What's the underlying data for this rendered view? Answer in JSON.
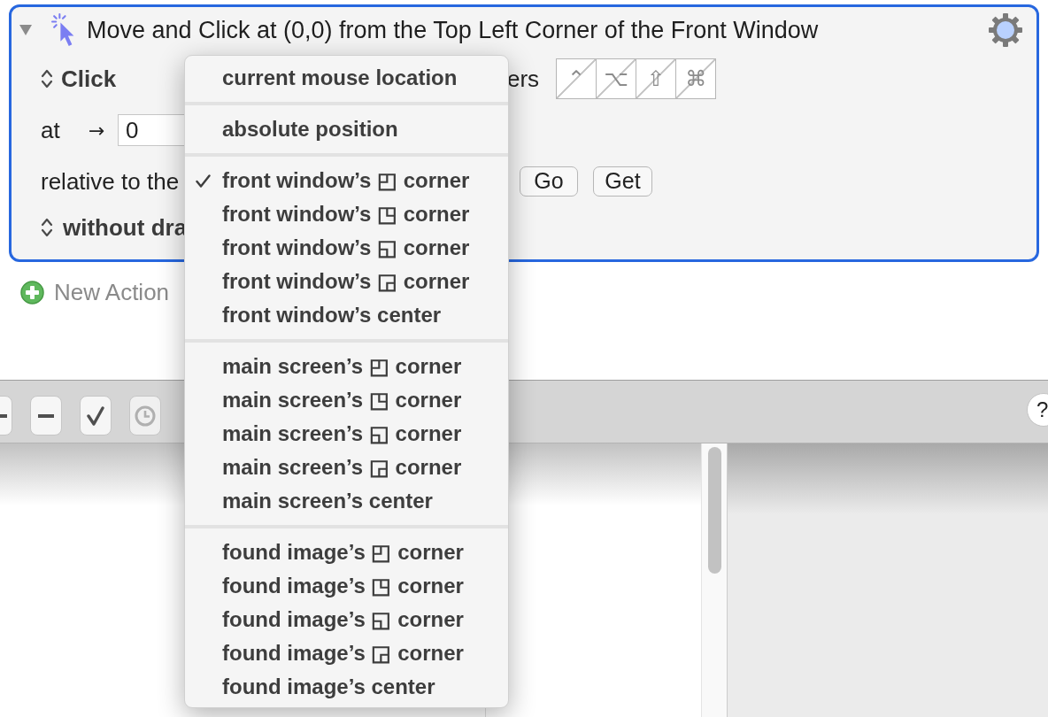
{
  "action": {
    "expanded": true,
    "title": "Move and Click at (0,0) from the Top Left Corner of the Front Window",
    "click_type": "Click",
    "modifiers_label": "ers",
    "modifiers": [
      {
        "symbol": "⌃",
        "on": false
      },
      {
        "symbol": "⌥",
        "on": false
      },
      {
        "symbol": "⇧",
        "on": false
      },
      {
        "symbol": "⌘",
        "on": false
      }
    ],
    "at_label": "at",
    "arrow": "→",
    "x_field": {
      "value": "0"
    },
    "relative_label": "relative to the",
    "buttons": [
      "Go",
      "Get"
    ],
    "drag_mode": "without dra"
  },
  "new_action": {
    "label": "New Action"
  },
  "toolbar": {
    "buttons": [
      {
        "kind": "minus",
        "disabled": false
      },
      {
        "kind": "minus",
        "disabled": false
      },
      {
        "kind": "check",
        "disabled": false
      },
      {
        "kind": "clock",
        "disabled": true
      }
    ],
    "help": "?"
  },
  "menu": {
    "sections": [
      {
        "items": [
          {
            "label": "current mouse location",
            "selected": false
          }
        ]
      },
      {
        "items": [
          {
            "label": "absolute position",
            "selected": false
          }
        ]
      },
      {
        "items": [
          {
            "label": "front window’s ◰ corner",
            "selected": true
          },
          {
            "label": "front window’s ◳ corner",
            "selected": false
          },
          {
            "label": "front window’s ◱ corner",
            "selected": false
          },
          {
            "label": "front window’s ◲ corner",
            "selected": false
          },
          {
            "label": "front window’s center",
            "selected": false
          }
        ]
      },
      {
        "items": [
          {
            "label": "main screen’s ◰ corner",
            "selected": false
          },
          {
            "label": "main screen’s ◳ corner",
            "selected": false
          },
          {
            "label": "main screen’s ◱ corner",
            "selected": false
          },
          {
            "label": "main screen’s ◲ corner",
            "selected": false
          },
          {
            "label": "main screen’s center",
            "selected": false
          }
        ]
      },
      {
        "items": [
          {
            "label": "found image’s ◰ corner",
            "selected": false
          },
          {
            "label": "found image’s ◳ corner",
            "selected": false
          },
          {
            "label": "found image’s ◱ corner",
            "selected": false
          },
          {
            "label": "found image’s ◲ corner",
            "selected": false
          },
          {
            "label": "found image’s center",
            "selected": false
          }
        ]
      }
    ]
  }
}
